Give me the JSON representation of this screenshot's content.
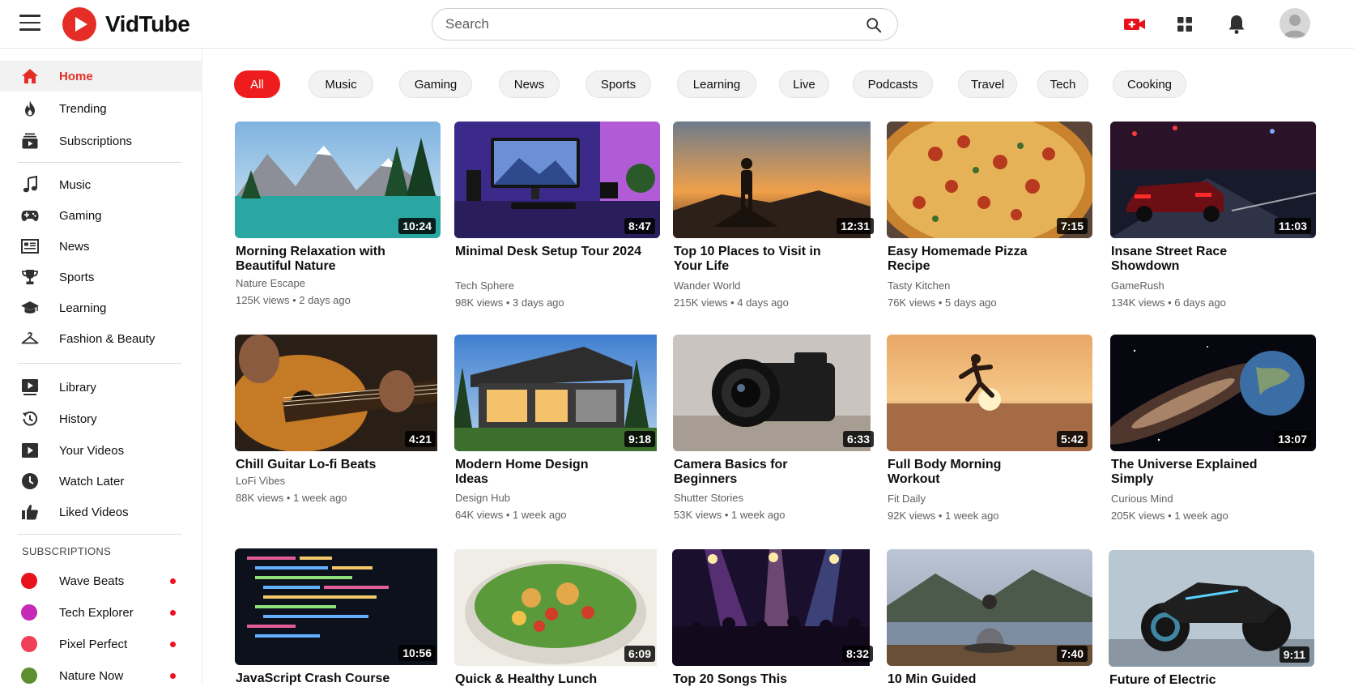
{
  "app": {
    "name": "VidTube"
  },
  "search": {
    "placeholder": "Search"
  },
  "sidebar": {
    "main": [
      {
        "label": "Home"
      },
      {
        "label": "Trending"
      },
      {
        "label": "Subscriptions"
      }
    ],
    "explore": [
      {
        "label": "Music"
      },
      {
        "label": "Gaming"
      },
      {
        "label": "News"
      },
      {
        "label": "Sports"
      },
      {
        "label": "Learning"
      },
      {
        "label": "Fashion & Beauty"
      }
    ],
    "you": [
      {
        "label": "Library"
      },
      {
        "label": "History"
      },
      {
        "label": "Your Videos"
      },
      {
        "label": "Watch Later"
      },
      {
        "label": "Liked Videos"
      }
    ],
    "subscriptions_title": "SUBSCRIPTIONS",
    "subscriptions": [
      {
        "label": "Wave Beats",
        "color": "#e8121c"
      },
      {
        "label": "Tech Explorer",
        "color": "#c42ab5"
      },
      {
        "label": "Pixel Perfect",
        "color": "#ee4058"
      },
      {
        "label": "Nature Now",
        "color": "#5d8f2e"
      }
    ]
  },
  "chips": [
    "All",
    "Music",
    "Gaming",
    "News",
    "Sports",
    "Learning",
    "Live",
    "Podcasts",
    "Travel",
    "Tech",
    "Cooking"
  ],
  "videos": [
    {
      "title": "Morning Relaxation with Beautiful Nature",
      "channel": "Nature Escape",
      "views": "125K views",
      "age": "2 days ago",
      "duration": "10:24"
    },
    {
      "title": "Minimal Desk Setup Tour 2024",
      "channel": "Tech Sphere",
      "views": "98K views",
      "age": "3 days ago",
      "duration": "8:47"
    },
    {
      "title": "Top 10 Places to Visit in Your Life",
      "channel": "Wander World",
      "views": "215K views",
      "age": "4 days ago",
      "duration": "12:31"
    },
    {
      "title": "Easy Homemade Pizza Recipe",
      "channel": "Tasty Kitchen",
      "views": "76K views",
      "age": "5 days ago",
      "duration": "7:15"
    },
    {
      "title": "Insane Street Race Showdown",
      "channel": "GameRush",
      "views": "134K views",
      "age": "6 days ago",
      "duration": "11:03"
    },
    {
      "title": "Chill Guitar Lo-fi Beats",
      "channel": "LoFi Vibes",
      "views": "88K views",
      "age": "1 week ago",
      "duration": "4:21"
    },
    {
      "title": "Modern Home Design Ideas",
      "channel": "Design Hub",
      "views": "64K views",
      "age": "1 week ago",
      "duration": "9:18"
    },
    {
      "title": "Camera Basics for Beginners",
      "channel": "Shutter Stories",
      "views": "53K views",
      "age": "1 week ago",
      "duration": "6:33"
    },
    {
      "title": "Full Body Morning Workout",
      "channel": "Fit Daily",
      "views": "92K views",
      "age": "1 week ago",
      "duration": "5:42"
    },
    {
      "title": "The Universe Explained Simply",
      "channel": "Curious Mind",
      "views": "205K views",
      "age": "1 week ago",
      "duration": "13:07"
    },
    {
      "title": "JavaScript Crash Course",
      "channel": "",
      "views": "",
      "age": "",
      "duration": "10:56"
    },
    {
      "title": "Quick & Healthy Lunch",
      "channel": "",
      "views": "",
      "age": "",
      "duration": "6:09"
    },
    {
      "title": "Top 20 Songs This",
      "channel": "",
      "views": "",
      "age": "",
      "duration": "8:32"
    },
    {
      "title": "10 Min Guided",
      "channel": "",
      "views": "",
      "age": "",
      "duration": "7:40"
    },
    {
      "title": "Future of Electric",
      "channel": "",
      "views": "",
      "age": "",
      "duration": "9:11"
    }
  ],
  "colors": {
    "brand": "#e52d27",
    "chip_active": "#ee1c1c",
    "live_dot": "#ee1122"
  }
}
